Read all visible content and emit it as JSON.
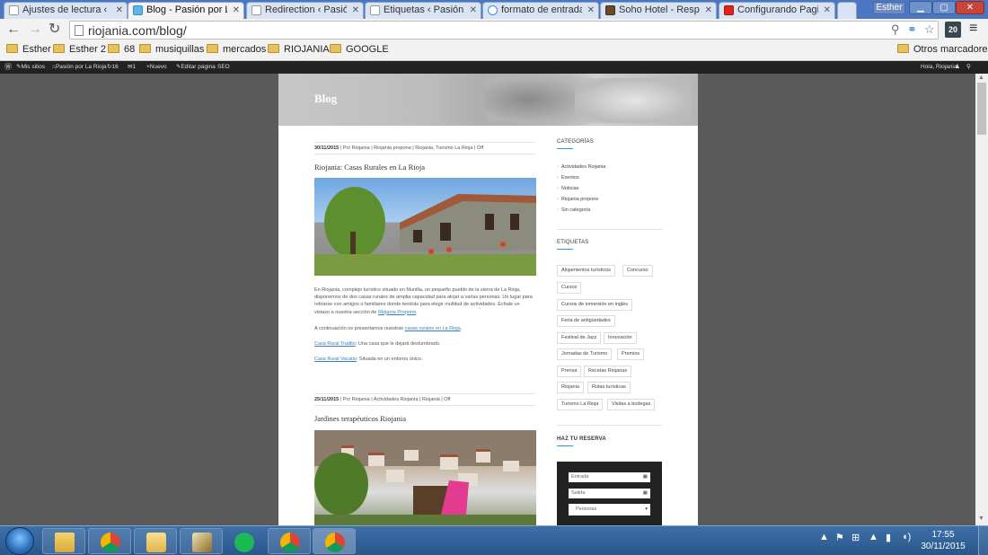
{
  "browser": {
    "tabs": [
      {
        "title": "Ajustes de lectura ‹ R",
        "active": false
      },
      {
        "title": "Blog - Pasión por La",
        "active": true
      },
      {
        "title": "Redirection ‹ Pasión",
        "active": false
      },
      {
        "title": "Etiquetas ‹ Pasión po",
        "active": false
      },
      {
        "title": "formato de entrada",
        "active": false
      },
      {
        "title": "Soho Hotel - Respo",
        "active": false
      },
      {
        "title": "Configurando Pagin",
        "active": false
      }
    ],
    "profile": "Esther",
    "url": "riojania.com/blog/",
    "extension_badge": "20",
    "bookmarks": [
      "Esther",
      "Esther 2",
      "68",
      "musiquillas",
      "mercados",
      "RIOJANIA",
      "GOOGLE"
    ],
    "other_bookmarks": "Otros marcadores"
  },
  "adminbar": {
    "my_sites": "Mis sitios",
    "site_name": "Pasión por La Rioja",
    "updates": "16",
    "comments": "1",
    "new": "Nuevo",
    "edit_page": "Editar página",
    "seo": "SEO",
    "greeting": "Hola, Riojania"
  },
  "page": {
    "hero_title": "Blog",
    "posts": [
      {
        "meta_date": "30/11/2015",
        "meta_rest": " | Por Riojania | Riojania propone | Riojania, Turismo La Rioja | Off",
        "title": "Riojania: Casas Rurales en La Rioja",
        "para1_before": "En Riojania, complejo turístico situado en Munilla, un pequeño pueblo de la sierra de La Rioja, disponemos de dos casas rurales de amplia capacidad para alojar a varias personas. Un lugar para retirarse con amigos o familiares donde tendrás para elegir multitud de actividades. Échale un vistazo a nuestra sección de ",
        "para1_link": "Riojania Propone",
        "para1_after": ".",
        "para2_before": "A continuación os presentamos nuestras ",
        "para2_link": "casas rurales en La Rioja",
        "para2_after": ".",
        "para3_link": "Casa Rural Tradito",
        "para3_after": ": Una casa que le dejará deslumbrado.",
        "para4_link": "Casa Rural Vacatio",
        "para4_after": ": Situada en un entorno único."
      },
      {
        "meta_date": "25/11/2015",
        "meta_rest": " | Por Riojania | Actividades Riojania | Riojania | Off",
        "title": "Jardines terapéuticos Riojania"
      }
    ]
  },
  "sidebar": {
    "categories_heading": "CATEGORÍAS",
    "categories": [
      "Actividades Riojania",
      "Eventos",
      "Noticias",
      "Riojania propone",
      "Sin categoría"
    ],
    "tags_heading": "ETIQUETAS",
    "tags": [
      "Alojamientos turísticos",
      "Concurso",
      "Cursos",
      "Cursos de inmersión en inglés",
      "Feria de antigüedades",
      "Festival de Jazz",
      "Innovación",
      "Jornadas de Turismo",
      "Premios",
      "Prensa",
      "Recetas Riojanas",
      "Riojania",
      "Rutas turísticas",
      "Turismo La Rioja",
      "Visitas a bodegas"
    ],
    "booking_heading": "HAZ TU RESERVA",
    "booking": {
      "checkin": "Entrada",
      "checkout": "Salida",
      "people": "Personas"
    }
  },
  "taskbar": {
    "time": "17:55",
    "date": "30/11/2015"
  }
}
